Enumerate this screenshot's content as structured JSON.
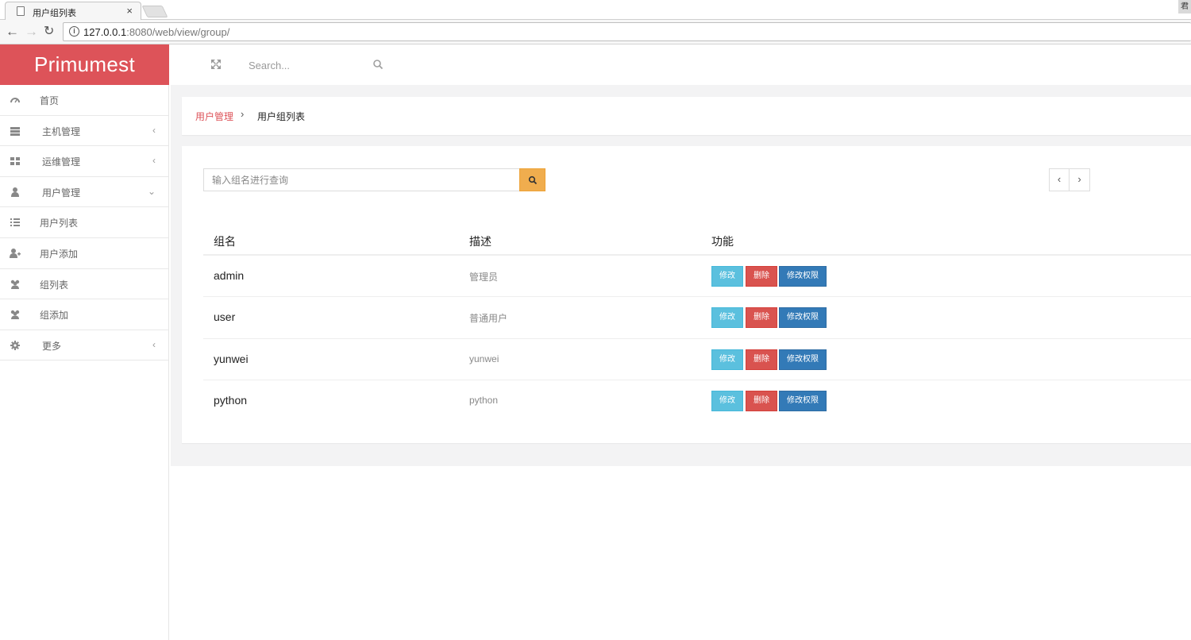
{
  "browser": {
    "tab_title": "用户组列表",
    "tab_close": "×",
    "corner_label": "君",
    "url_host": "127.0.0.1",
    "url_rest": ":8080/web/view/group/"
  },
  "app": {
    "brand": "Primumest",
    "search_placeholder": "Search..."
  },
  "sidebar": {
    "items": [
      {
        "label": "首页",
        "icon": "dashboard-icon"
      },
      {
        "label": "主机管理",
        "icon": "server-icon",
        "arrow": "‹"
      },
      {
        "label": "运维管理",
        "icon": "grid-icon",
        "arrow": "‹"
      },
      {
        "label": "用户管理",
        "icon": "user-icon",
        "arrow": "⌄"
      },
      {
        "label": "用户列表",
        "icon": "list-icon"
      },
      {
        "label": "用户添加",
        "icon": "user-plus-icon"
      },
      {
        "label": "组列表",
        "icon": "users-icon"
      },
      {
        "label": "组添加",
        "icon": "users-icon"
      },
      {
        "label": "更多",
        "icon": "gear-icon",
        "arrow": "‹"
      }
    ]
  },
  "breadcrumb": {
    "parent": "用户管理",
    "separator": "›",
    "current": "用户组列表"
  },
  "group_search": {
    "placeholder": "输入组名进行查询"
  },
  "pager": {
    "prev": "‹",
    "next": "›"
  },
  "table": {
    "headers": [
      "组名",
      "描述",
      "功能"
    ],
    "buttons": {
      "edit": "修改",
      "delete": "删除",
      "permissions": "修改权限"
    },
    "rows": [
      {
        "name": "admin",
        "description": "管理员"
      },
      {
        "name": "user",
        "description": "普通用户"
      },
      {
        "name": "yunwei",
        "description": "yunwei"
      },
      {
        "name": "python",
        "description": "python"
      }
    ]
  },
  "colors": {
    "brand": "#dd5359",
    "search_button": "#f0ad4e",
    "edit_button": "#5bc0de",
    "delete_button": "#d9534f",
    "permission_button": "#337ab7"
  }
}
